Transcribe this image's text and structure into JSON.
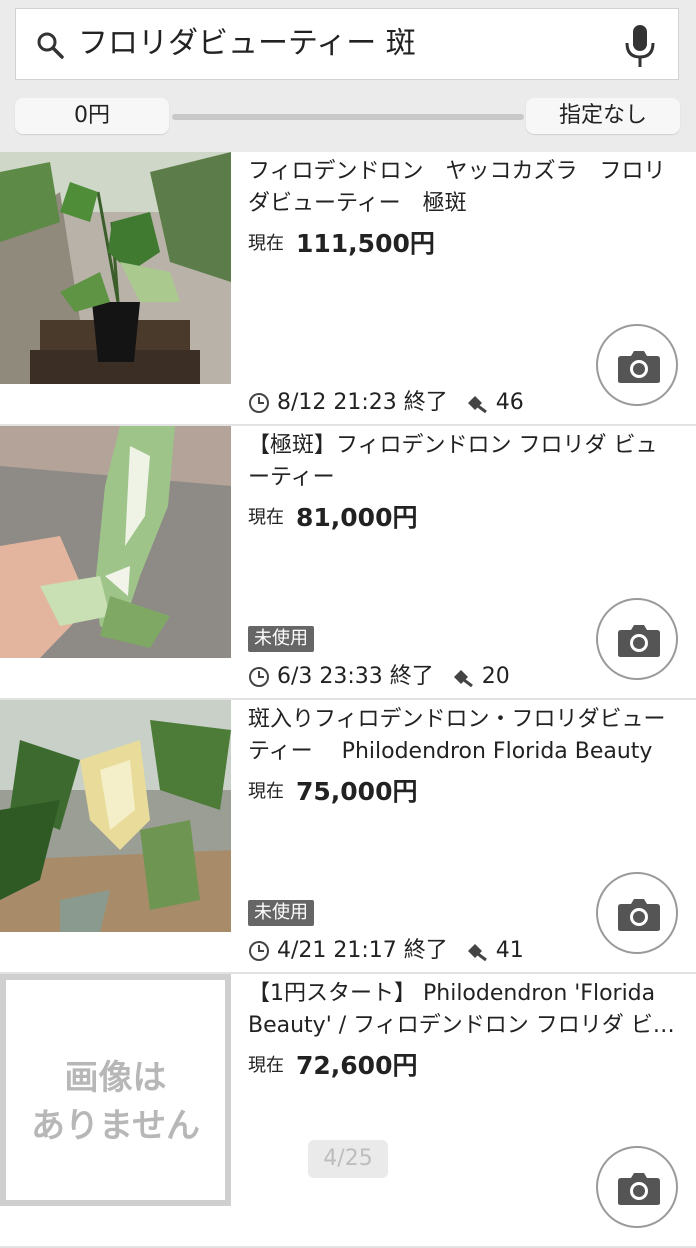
{
  "search": {
    "query": "フロリダビューティー 斑"
  },
  "price_filter": {
    "min_label": "0円",
    "max_label": "指定なし"
  },
  "items": [
    {
      "title": "フィロデンドロン　ヤッコカズラ　フロリダビューティー　極斑",
      "price_label": "現在",
      "price": "111,500円",
      "badge": "",
      "end_time": "8/12 21:23 終了",
      "bids": "46"
    },
    {
      "title": "【極斑】フィロデンドロン フロリダ ビューティー",
      "price_label": "現在",
      "price": "81,000円",
      "badge": "未使用",
      "end_time": "6/3 23:33 終了",
      "bids": "20"
    },
    {
      "title": "斑入りフィロデンドロン・フロリダビューティー　 Philodendron Florida Beauty",
      "price_label": "現在",
      "price": "75,000円",
      "badge": "未使用",
      "end_time": "4/21 21:17 終了",
      "bids": "41"
    },
    {
      "title": "【1円スタート】 Philodendron 'Florida Beauty' / フィロデンドロン フロリダ ビ…",
      "price_label": "現在",
      "price": "72,600円",
      "no_image_line1": "画像は",
      "no_image_line2": "ありません"
    }
  ],
  "pager": {
    "text": "4/25"
  },
  "colors": {
    "badge": "#666666",
    "divider": "#e2e2e2",
    "header_bg": "#ebebeb"
  }
}
